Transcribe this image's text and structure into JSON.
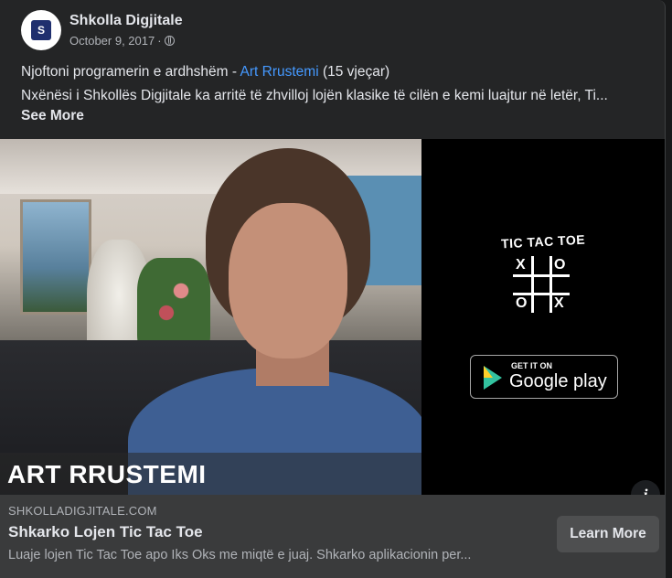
{
  "post": {
    "page_name": "Shkolla Digjitale",
    "date": "October 9, 2017",
    "separator": "·",
    "text_prefix": "Njoftoni programerin e ardhshëm - ",
    "text_link": "Art Rrustemi",
    "text_suffix": " (15 vjeçar)",
    "text_line2": "Nxënësi i Shkollës Digjitale ka arritë të zhvilloj lojën klasike të cilën e kemi luajtur në letër, Ti...",
    "see_more": "See More",
    "link_color": "#4599ff"
  },
  "media": {
    "name_caption": "ART RRUSTEMI",
    "promo_title": "TIC TAC TOE",
    "grid_marks": [
      "X",
      "O",
      "O",
      "X"
    ],
    "badge_top": "GET IT ON",
    "badge_main": "Google play",
    "info_icon": "info-icon",
    "info_glyph": "i"
  },
  "link_preview": {
    "domain": "SHKOLLADIGJITALE.COM",
    "title": "Shkarko Lojen Tic Tac Toe",
    "description": "Luaje lojen Tic Tac Toe apo Iks Oks me miqtë e juaj. Shkarko aplikacionin per...",
    "cta": "Learn More"
  },
  "colors": {
    "background": "#18191a",
    "card": "#242526",
    "footer": "#3a3b3c"
  }
}
